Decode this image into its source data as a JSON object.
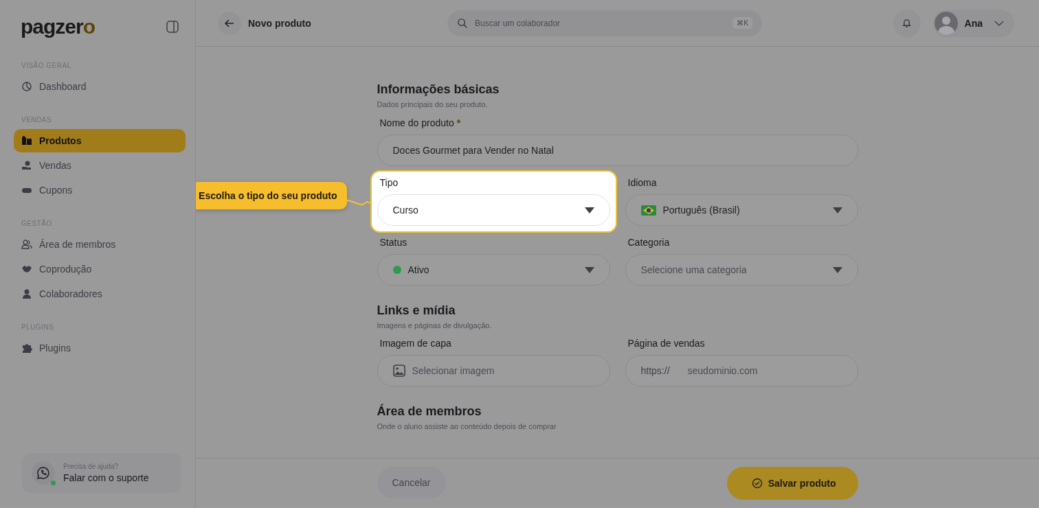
{
  "sidebar": {
    "logo": "pagzero",
    "sections": [
      {
        "heading": "VISÃO GERAL",
        "items": [
          {
            "label": "Dashboard",
            "selected": false
          }
        ]
      },
      {
        "heading": "VENDAS",
        "items": [
          {
            "label": "Produtos",
            "selected": true
          },
          {
            "label": "Vendas",
            "selected": false
          },
          {
            "label": "Cupons",
            "selected": false
          }
        ]
      },
      {
        "heading": "GESTÃO",
        "items": [
          {
            "label": "Área de membros",
            "selected": false
          },
          {
            "label": "Coprodução",
            "selected": false
          },
          {
            "label": "Colaboradores",
            "selected": false
          }
        ]
      },
      {
        "heading": "PLUGINS",
        "items": [
          {
            "label": "Plugins",
            "selected": false
          }
        ]
      }
    ],
    "support": {
      "caption": "Precisa de ajuda?",
      "label": "Falar com o suporte",
      "online": true
    }
  },
  "topbar": {
    "title": "Novo produto",
    "search": {
      "placeholder": "Buscar um colaborador",
      "shortcut": "⌘K"
    },
    "user": "Ana"
  },
  "sections": [
    {
      "title": "Informações básicas",
      "subtitle": "Dados principais do seu produto.",
      "fields": [
        {
          "kind": "text",
          "label": "Nome do produto",
          "required_mark": "*",
          "value": "Doces Gourmet para Vender no Natal",
          "highlighted": false
        },
        {
          "kind": "select",
          "label": "Tipo",
          "value": "Curso",
          "highlighted": true,
          "tooltip": "Escolha o tipo do seu produto"
        },
        {
          "kind": "language-select",
          "label": "Idioma",
          "value": "Português (Brasil)",
          "highlighted": false
        },
        {
          "kind": "status-select",
          "label": "Status",
          "value": "Ativo",
          "color": "#2f9a4e",
          "highlighted": false
        },
        {
          "kind": "select",
          "label": "Categoria",
          "placeholder": "Selecione uma categoria",
          "highlighted": false
        }
      ]
    },
    {
      "title": "Links e mídia",
      "subtitle": "Imagens e páginas de divulgação.",
      "fields": [
        {
          "kind": "image-upload",
          "label": "Imagem de capa",
          "placeholder": "Selecionar imagem",
          "highlighted": false
        },
        {
          "kind": "url",
          "label": "Página de vendas",
          "prefix": "https://",
          "placeholder": "seudominio.com",
          "highlighted": false
        }
      ]
    },
    {
      "title": "Área de membros",
      "subtitle": "Onde o aluno assiste ao conteúdo depois de comprar"
    }
  ],
  "footer": {
    "cancel": "Cancelar",
    "save": "Salvar produto"
  }
}
